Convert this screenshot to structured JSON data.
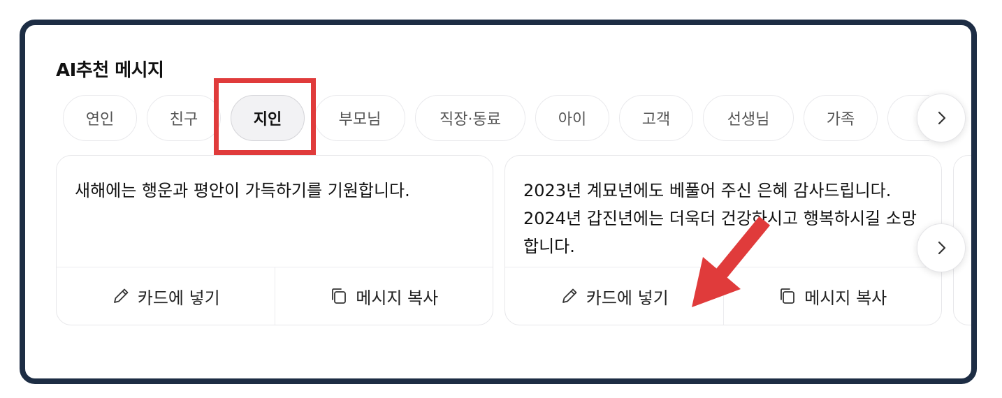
{
  "section": {
    "title": "AI추천 메시지"
  },
  "tabs": [
    {
      "label": "연인"
    },
    {
      "label": "친구"
    },
    {
      "label": "지인",
      "active": true
    },
    {
      "label": "부모님"
    },
    {
      "label": "직장·동료"
    },
    {
      "label": "아이"
    },
    {
      "label": "고객"
    },
    {
      "label": "선생님"
    },
    {
      "label": "가족"
    }
  ],
  "cards": [
    {
      "message": "새해에는 행운과 평안이 가득하기를 기원합니다.",
      "insert_label": "카드에 넣기",
      "copy_label": "메시지 복사"
    },
    {
      "message": "2023년 계묘년에도 베풀어 주신 은혜 감사드립니다. 2024년 갑진년에는 더욱더 건강하시고 행복하시길 소망합니다.",
      "insert_label": "카드에 넣기",
      "copy_label": "메시지 복사"
    }
  ],
  "icons": {
    "next": "chevron-right-icon",
    "insert": "pencil-icon",
    "copy": "copy-icon"
  },
  "colors": {
    "frame": "#1d2d44",
    "highlight": "#e03b3b",
    "annotation_arrow": "#e03b3b",
    "active_chip_bg": "#f2f2f4"
  }
}
